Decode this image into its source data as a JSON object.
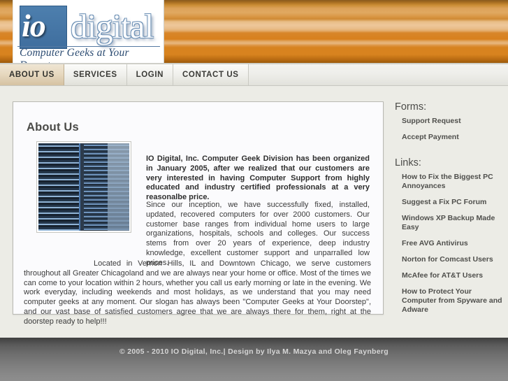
{
  "logo": {
    "mark": "io",
    "word": "digital",
    "tagline": "Computer Geeks at Your Doorstep"
  },
  "nav": {
    "items": [
      {
        "label": "ABOUT US",
        "active": true
      },
      {
        "label": "SERVICES",
        "active": false
      },
      {
        "label": "LOGIN",
        "active": false
      },
      {
        "label": "CONTACT US",
        "active": false
      }
    ]
  },
  "main": {
    "title": "About Us",
    "photo_alt": "server-racks-photo",
    "paragraphs": [
      "IO Digital, Inc. Computer Geek Division has been organized in January 2005, after we realized that our customers are very interested in having Computer Support from highly educated and industry certified professionals at a very reasonalbe price.",
      "Since our inception, we have successfully fixed, installed, updated, recovered computers for over 2000 customers. Our customer base ranges from individual home users to large organizations, hospitals, schools and colleges. Our success stems from over 20 years of experience, deep industry knowledge, excellent customer support and unparralled low prices.",
      "Located in Vernon Hills, IL and Downtown Chicago, we serve customers throughout all Greater Chicagoland and we are always near your home or office. Most of the times we can come to your location within 2 hours, whether you call us early morning or late in the evening. We work everyday, including weekends and most holidays, as we understand that you may need computer geeks at any moment. Our slogan has always been \"Computer Geeks at Your Doorstep\", and our vast base of satisfied customers agree that we are always there for them, right at the doorstep ready to help!!!"
    ]
  },
  "sidebar": {
    "forms_heading": "Forms:",
    "forms": [
      "Support Request",
      "Accept Payment"
    ],
    "links_heading": "Links:",
    "links": [
      "How to Fix the Biggest PC Annoyances",
      "Suggest a Fix PC Forum",
      "Windows XP Backup Made Easy",
      "Free AVG Antivirus",
      "Norton for Comcast Users",
      "McAfee for AT&T Users",
      "How to Protect Your Computer from Spyware and Adware"
    ]
  },
  "footer": {
    "copyright": "© 2005 - 2010 IO Digital, Inc.| Design by Ilya M. Mazya and Oleg Faynberg"
  },
  "colors": {
    "banner_orange": "#d8831f",
    "logo_blue": "#3f6e9e",
    "active_tab": "#e7d9c0",
    "page_bg": "#ecece6",
    "footer_gray": "#7d7d7d"
  }
}
